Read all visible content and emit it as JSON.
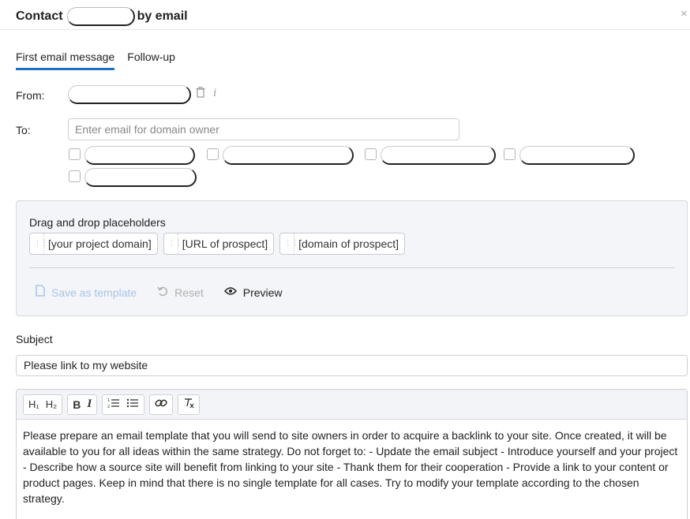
{
  "header": {
    "title_prefix": "Contact",
    "title_suffix": "by email",
    "close_symbol": "×"
  },
  "tabs": [
    {
      "label": "First email message",
      "active": true
    },
    {
      "label": "Follow-up",
      "active": false
    }
  ],
  "from": {
    "label": "From:",
    "delete_icon": "trash-icon",
    "info_icon": "info-icon"
  },
  "to": {
    "label": "To:",
    "placeholder": "Enter email for domain owner",
    "recipient_count": 5
  },
  "placeholders": {
    "title": "Drag and drop placeholders",
    "chips": [
      "[your project domain]",
      "[URL of prospect]",
      "[domain of prospect]"
    ],
    "actions": {
      "save_template": "Save as template",
      "reset": "Reset",
      "preview": "Preview"
    }
  },
  "subject": {
    "label": "Subject",
    "value": "Please link to my website"
  },
  "editor": {
    "toolbar": {
      "h1": "H₁",
      "h2": "H₂",
      "bold": "B",
      "italic": "I",
      "ordered_list": "☰",
      "bullet_list": "☰",
      "link": "⚭",
      "clear_format": "T"
    },
    "body": "Please prepare an email template that you will send to site owners in order to acquire a backlink to your site. Once created, it will be available to you for all ideas within the same strategy. Do not forget to: - Update the email subject - Introduce yourself and your project - Describe how a source site will benefit from linking to your site - Thank them for their cooperation - Provide a link to your content or product pages. Keep in mind that there is no single template for all cases. Try to modify your template according to the chosen strategy."
  },
  "colors": {
    "accent": "#1a6fc7",
    "disabled_action": "#a9c4e6",
    "panel_bg": "#f4f5f8"
  }
}
